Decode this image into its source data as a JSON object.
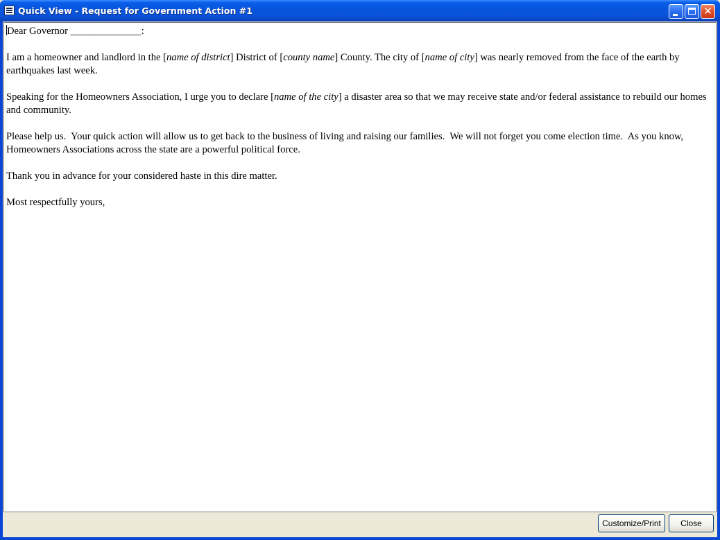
{
  "window": {
    "title": "Quick View - Request for Government Action #1"
  },
  "letter": {
    "salutation": "Dear Governor ______________:",
    "p1": {
      "t1": "I am a homeowner and landlord in the [",
      "i1": "name of district",
      "t2": "] District of [",
      "i2": "county name",
      "t3": "] County. The city of [",
      "i3": "name of city",
      "t4": "] was nearly removed from the face of the earth by earthquakes last week."
    },
    "p2": {
      "t1": "Speaking for the Homeowners Association, I urge you to declare [",
      "i1": "name of the city",
      "t2": "] a disaster area so that we may receive state and/or federal assistance to rebuild our homes and community."
    },
    "p3": "Please help us.  Your quick action will allow us to get back to the business of living and raising our families.  We will not forget you come election time.  As you know, Homeowners Associations across the state are a powerful political force.",
    "p4": "Thank you in advance for your considered haste in this dire matter.",
    "closing": "Most respectfully yours,"
  },
  "buttons": {
    "customize_label": "Customize/Print",
    "close_label": "Close"
  },
  "icons": {
    "window": "document-icon",
    "minimize": "minimize-icon",
    "maximize": "maximize-icon",
    "close": "close-icon"
  }
}
